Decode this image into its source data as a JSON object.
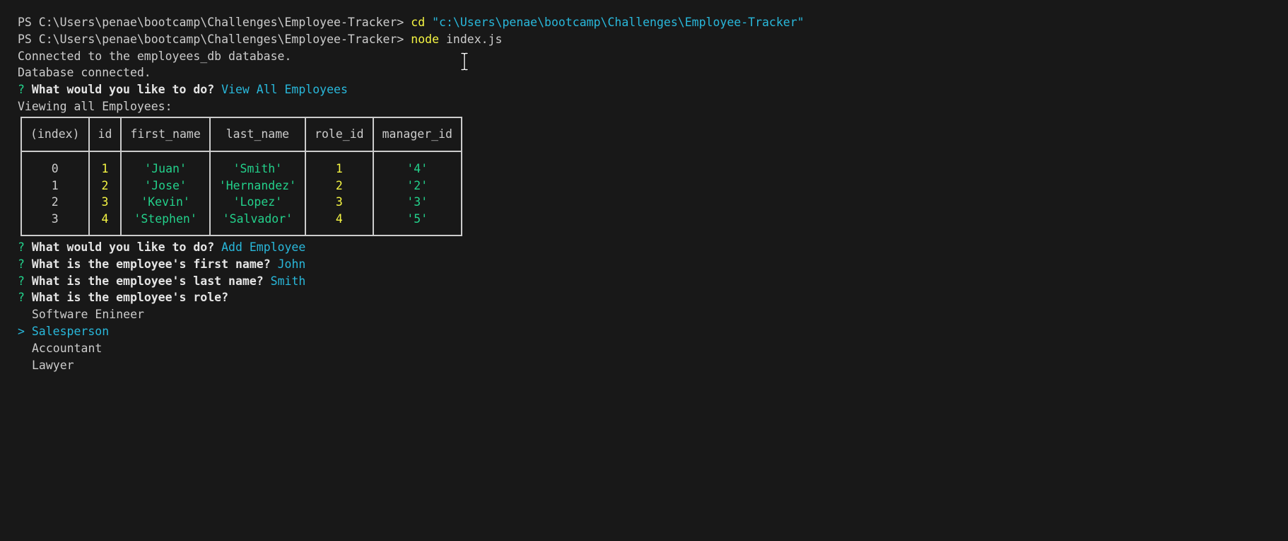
{
  "lines": {
    "ps1": "PS C:\\Users\\penae\\bootcamp\\Challenges\\Employee-Tracker> ",
    "cmd1_keyword": "cd",
    "cmd1_arg": "\"c:\\Users\\penae\\bootcamp\\Challenges\\Employee-Tracker\"",
    "ps2": "PS C:\\Users\\penae\\bootcamp\\Challenges\\Employee-Tracker> ",
    "cmd2_keyword": "node",
    "cmd2_arg": "index.js",
    "connected": "Connected to the employees_db database.",
    "db_connected": "Database connected.",
    "q_mark": "?",
    "q1_text": "What would you like to do?",
    "q1_answer": "View All Employees",
    "viewing": "Viewing all Employees:",
    "q2_text": "What would you like to do?",
    "q2_answer": "Add Employee",
    "q3_text": "What is the employee's first name?",
    "q3_answer": "John",
    "q4_text": "What is the employee's last name?",
    "q4_answer": "Smith",
    "q5_text": "What is the employee's role?"
  },
  "table": {
    "headers": [
      "(index)",
      "id",
      "first_name",
      "last_name",
      "role_id",
      "manager_id"
    ],
    "rows": [
      {
        "index": "0",
        "id": "1",
        "first_name": "'Juan'",
        "last_name": "'Smith'",
        "role_id": "1",
        "manager_id": "'4'"
      },
      {
        "index": "1",
        "id": "2",
        "first_name": "'Jose'",
        "last_name": "'Hernandez'",
        "role_id": "2",
        "manager_id": "'2'"
      },
      {
        "index": "2",
        "id": "3",
        "first_name": "'Kevin'",
        "last_name": "'Lopez'",
        "role_id": "3",
        "manager_id": "'3'"
      },
      {
        "index": "3",
        "id": "4",
        "first_name": "'Stephen'",
        "last_name": "'Salvador'",
        "role_id": "4",
        "manager_id": "'5'"
      }
    ]
  },
  "role_choices": {
    "pointer": ">",
    "items": [
      "Software Enineer",
      "Salesperson",
      "Accountant",
      "Lawyer"
    ],
    "selected_index": 1
  },
  "icons": {
    "text_cursor": "i-beam-cursor-icon"
  },
  "colors": {
    "background": "#181818",
    "text": "#cccccc",
    "prompt_green": "#23d18b",
    "answer_blue": "#29b8db",
    "number_yellow": "#f5f543"
  }
}
